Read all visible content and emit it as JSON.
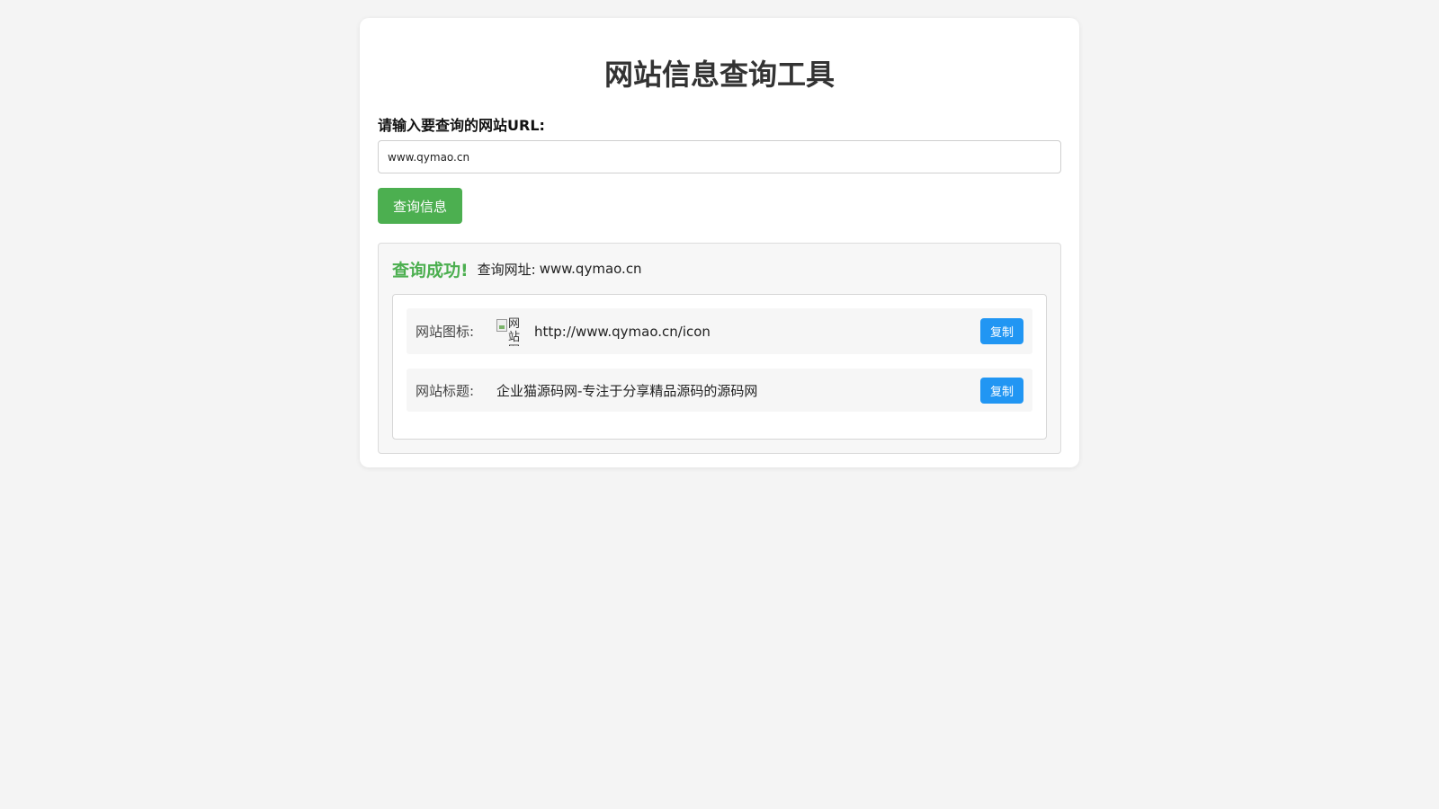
{
  "page": {
    "title": "网站信息查询工具"
  },
  "form": {
    "url_label": "请输入要查询的网站URL:",
    "url_value": "www.qymao.cn",
    "query_button": "查询信息"
  },
  "result": {
    "success_text": "查询成功!",
    "queried_label": "查询网址:",
    "queried_url": "www.qymao.cn",
    "rows": [
      {
        "label": "网站图标:",
        "icon_alt": "网站图",
        "value": "http://www.qymao.cn/icon",
        "copy_label": "复制"
      },
      {
        "label": "网站标题:",
        "value": "企业猫源码网-专注于分享精品源码的源码网",
        "copy_label": "复制"
      }
    ]
  },
  "colors": {
    "primary_green": "#4caf50",
    "copy_blue": "#2196f3",
    "background": "#f4f4f4"
  }
}
